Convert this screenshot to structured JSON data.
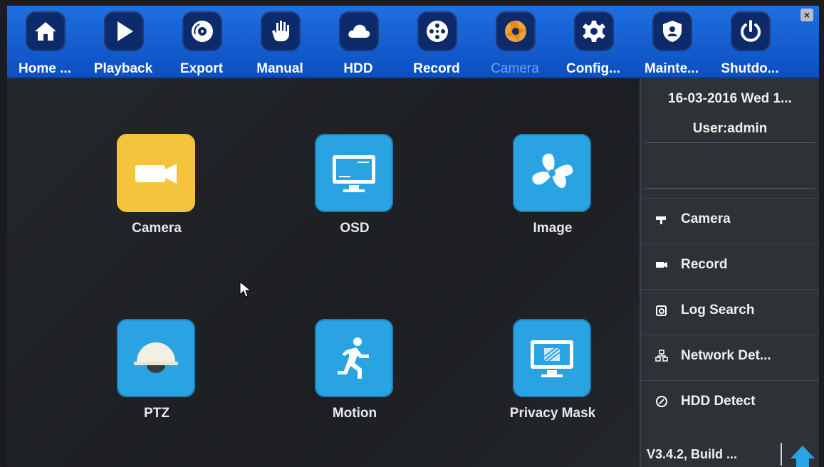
{
  "toolbar": {
    "items": [
      {
        "label": "Home ...",
        "icon": "home-icon"
      },
      {
        "label": "Playback",
        "icon": "play-icon"
      },
      {
        "label": "Export",
        "icon": "disc-icon"
      },
      {
        "label": "Manual",
        "icon": "hand-icon"
      },
      {
        "label": "HDD",
        "icon": "cloud-icon"
      },
      {
        "label": "Record",
        "icon": "film-reel-icon"
      },
      {
        "label": "Camera",
        "icon": "aperture-icon"
      },
      {
        "label": "Config...",
        "icon": "gear-icon"
      },
      {
        "label": "Mainte...",
        "icon": "shield-icon"
      },
      {
        "label": "Shutdo...",
        "icon": "power-icon"
      }
    ],
    "active": "Camera",
    "close_label": "×"
  },
  "main": {
    "tiles": [
      {
        "label": "Camera",
        "icon": "video-camera-icon"
      },
      {
        "label": "OSD",
        "icon": "monitor-icon"
      },
      {
        "label": "Image",
        "icon": "fan-icon"
      },
      {
        "label": "PTZ",
        "icon": "dome-camera-icon"
      },
      {
        "label": "Motion",
        "icon": "running-person-icon"
      },
      {
        "label": "Privacy Mask",
        "icon": "masked-monitor-icon"
      }
    ]
  },
  "side": {
    "datetime": "16-03-2016 Wed 1...",
    "user": "User:admin",
    "items": [
      {
        "label": "Camera",
        "icon": "camera-small-icon"
      },
      {
        "label": "Record",
        "icon": "record-small-icon"
      },
      {
        "label": "Log Search",
        "icon": "log-search-icon"
      },
      {
        "label": "Network Det...",
        "icon": "network-icon"
      },
      {
        "label": "HDD Detect",
        "icon": "hdd-detect-icon"
      }
    ],
    "version": "V3.4.2, Build ..."
  },
  "colors": {
    "toolbar_blue": "#1560d8",
    "tile_blue": "#2aa3e3",
    "tile_yellow": "#f4c53c",
    "active_label": "#6fa0f0"
  }
}
